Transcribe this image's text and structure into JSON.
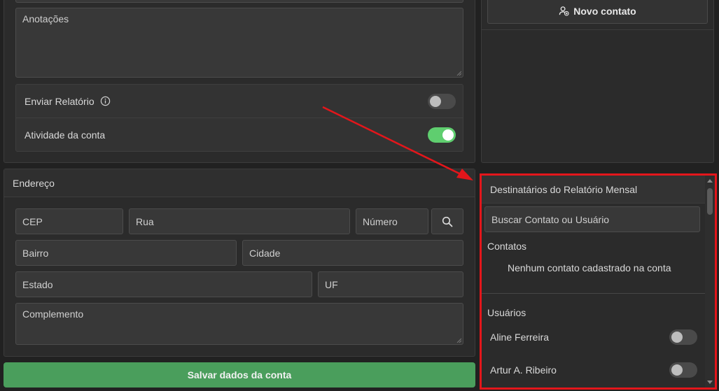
{
  "account": {
    "notes_placeholder": "Anotações",
    "send_report_label": "Enviar Relatório",
    "send_report_enabled": false,
    "account_activity_label": "Atividade da conta",
    "account_activity_enabled": true
  },
  "address": {
    "title": "Endereço",
    "cep_placeholder": "CEP",
    "street_placeholder": "Rua",
    "number_placeholder": "Número",
    "neighborhood_placeholder": "Bairro",
    "city_placeholder": "Cidade",
    "state_placeholder": "Estado",
    "uf_placeholder": "UF",
    "complement_placeholder": "Complemento"
  },
  "save_button_label": "Salvar dados da conta",
  "contacts_panel": {
    "new_contact_label": "Novo contato"
  },
  "recipients": {
    "title": "Destinatários do Relatório Mensal",
    "search_placeholder": "Buscar Contato ou Usuário",
    "contacts_heading": "Contatos",
    "contacts_empty": "Nenhum contato cadastrado na conta",
    "users_heading": "Usuários",
    "users": [
      {
        "name": "Aline Ferreira",
        "enabled": false
      },
      {
        "name": "Artur A. Ribeiro",
        "enabled": false
      }
    ]
  },
  "colors": {
    "accent_green": "#4a9e5c",
    "highlight_red": "#e3161b",
    "toggle_on": "#5fce6f"
  }
}
